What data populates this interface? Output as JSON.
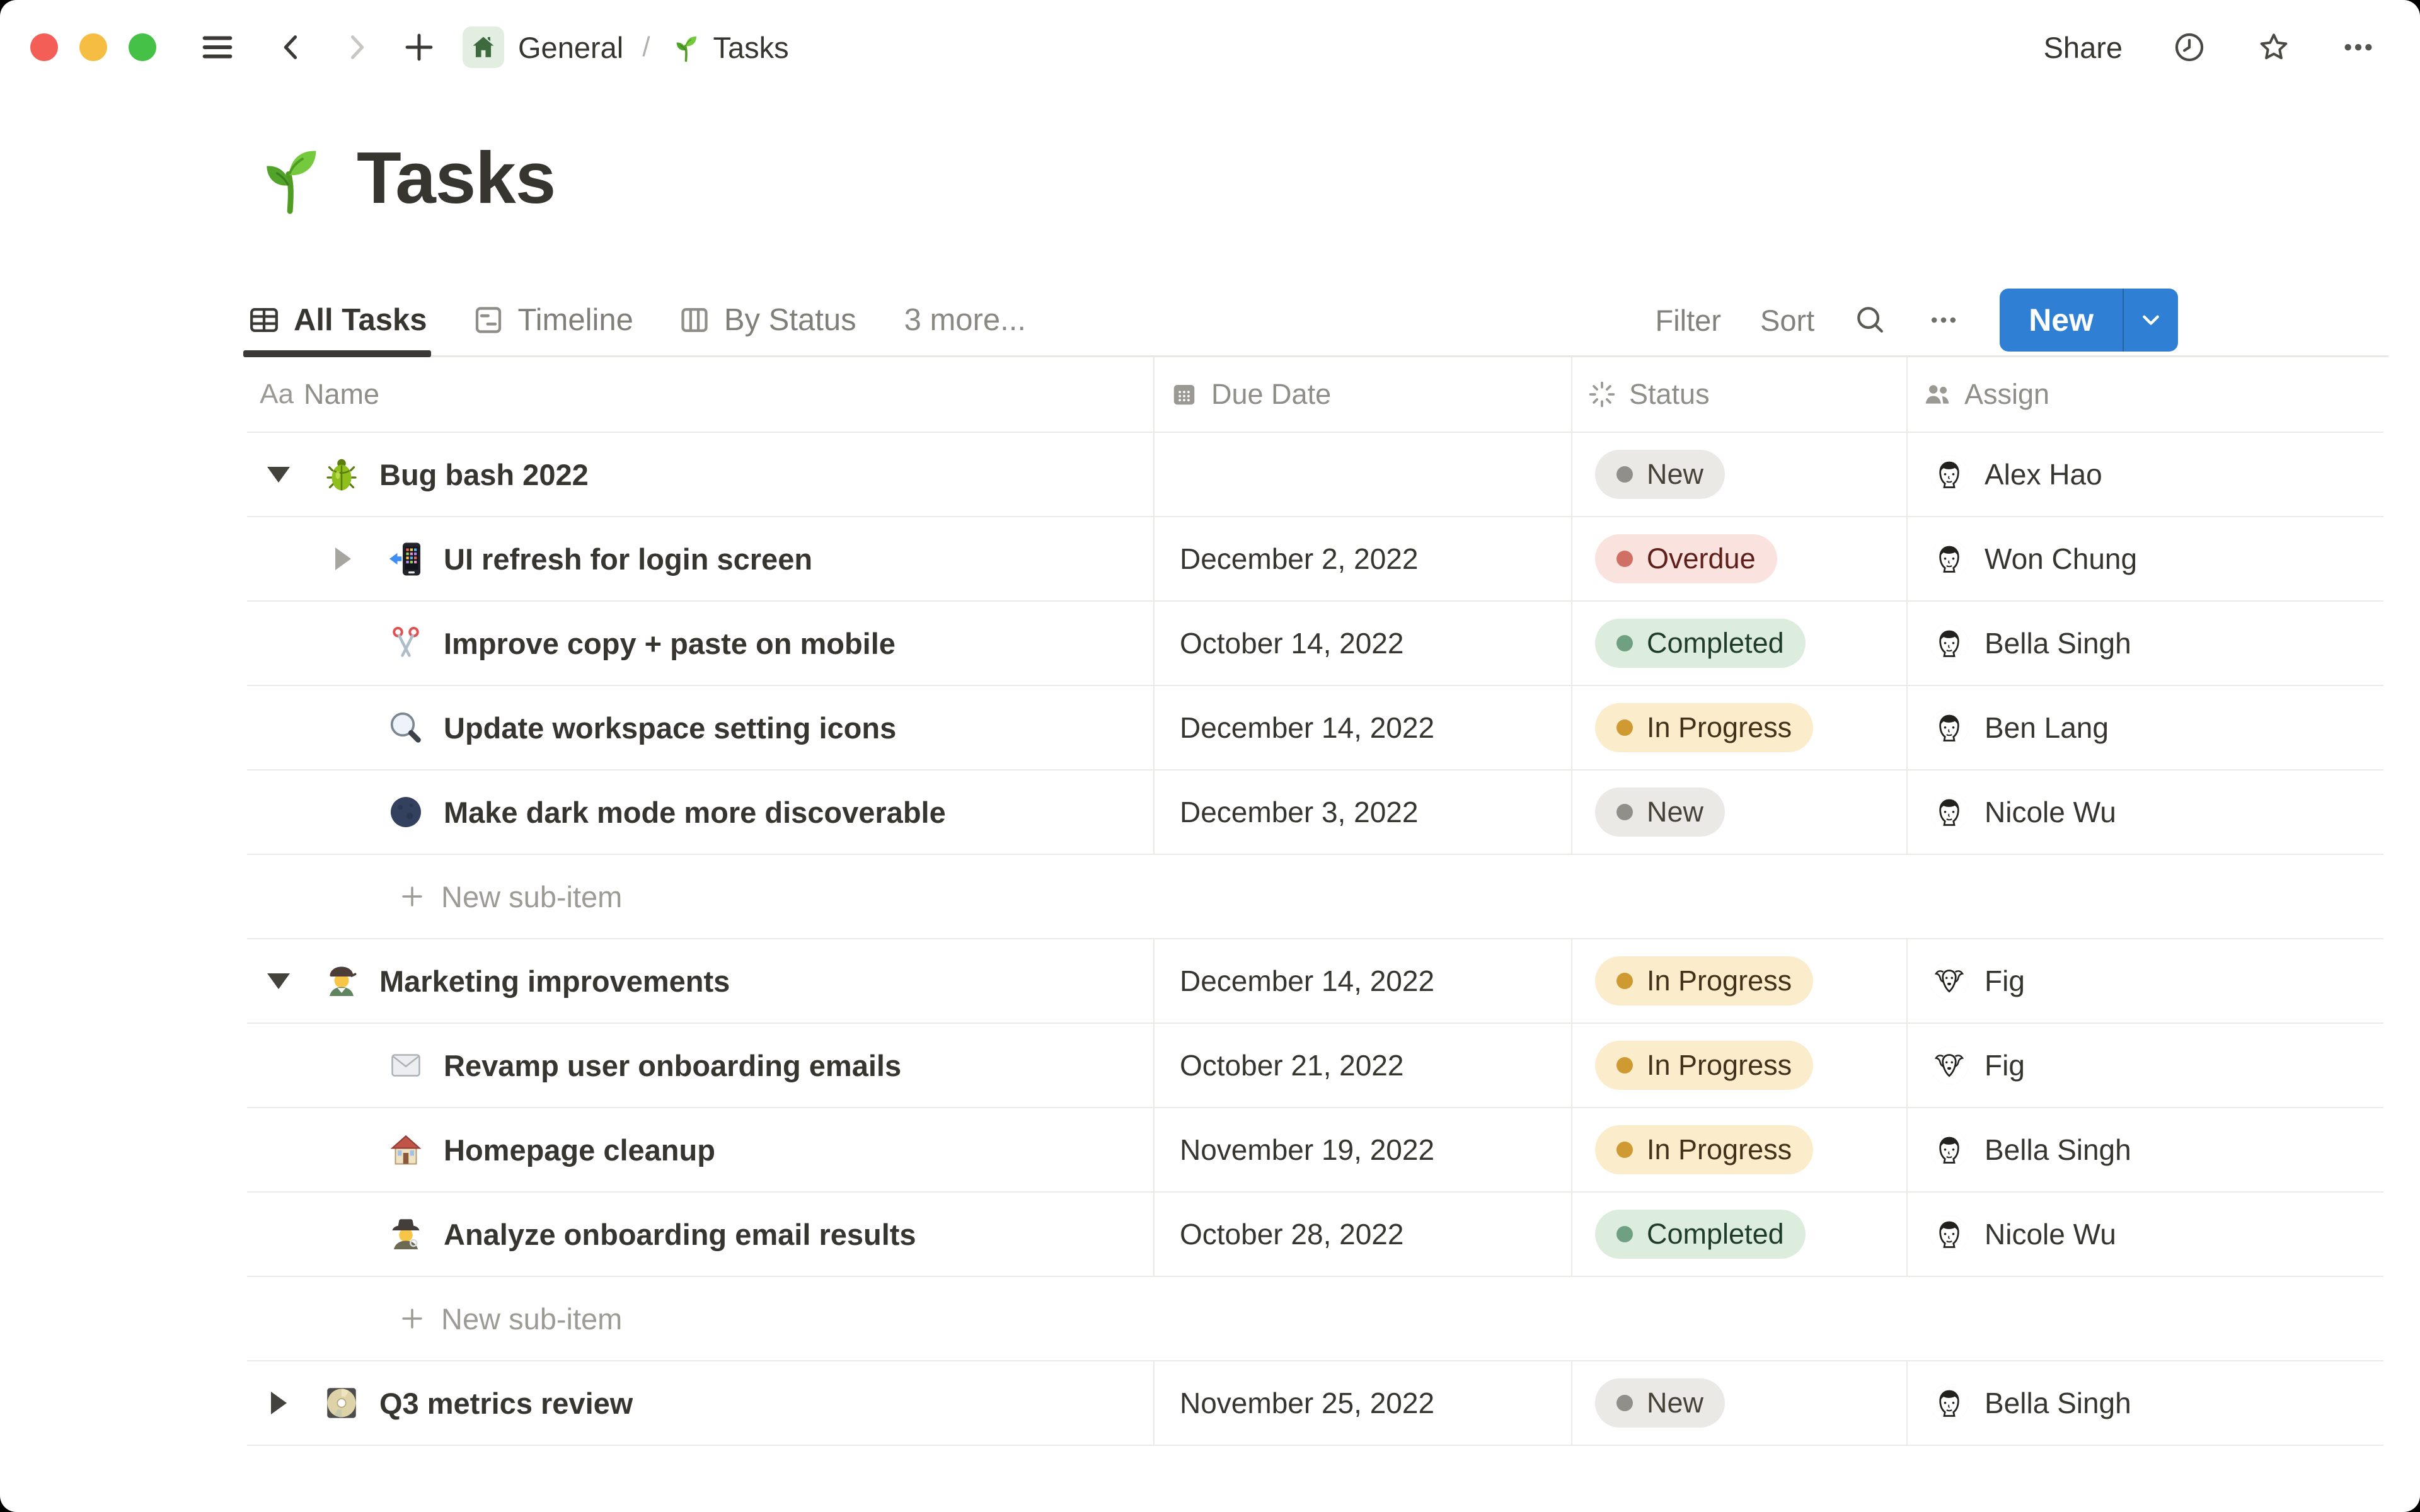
{
  "window_chrome": {
    "traffic_lights": [
      "close",
      "minimize",
      "zoom"
    ],
    "breadcrumb": {
      "workspace": "General",
      "separator": "/",
      "page": "Tasks",
      "workspace_icon": "home-icon",
      "page_icon": "seedling-icon"
    },
    "share_label": "Share"
  },
  "header": {
    "icon": "seedling-icon",
    "title": "Tasks"
  },
  "toolbar": {
    "tabs": [
      {
        "label": "All Tasks",
        "icon": "table-icon",
        "active": true
      },
      {
        "label": "Timeline",
        "icon": "timeline-icon",
        "active": false
      },
      {
        "label": "By Status",
        "icon": "board-icon",
        "active": false
      }
    ],
    "more_tabs_label": "3 more...",
    "filter_label": "Filter",
    "sort_label": "Sort",
    "new_button_label": "New"
  },
  "table": {
    "columns": [
      {
        "label": "Name",
        "icon": "text-icon"
      },
      {
        "label": "Due Date",
        "icon": "calendar-icon"
      },
      {
        "label": "Status",
        "icon": "status-burst-icon"
      },
      {
        "label": "Assign",
        "icon": "people-icon"
      }
    ],
    "new_sub_item_label": "New sub-item",
    "rows": [
      {
        "type": "task",
        "level": 1,
        "toggle": "open",
        "icon": "beetle",
        "name": "Bug bash 2022",
        "due": "",
        "status": {
          "label": "New",
          "type": "new"
        },
        "assignee": {
          "name": "Alex Hao",
          "avatar": "person"
        }
      },
      {
        "type": "task",
        "level": 2,
        "toggle": "closed-muted",
        "icon": "phone",
        "name": "UI refresh for login screen",
        "due": "December 2, 2022",
        "status": {
          "label": "Overdue",
          "type": "overdue"
        },
        "assignee": {
          "name": "Won Chung",
          "avatar": "person"
        }
      },
      {
        "type": "task",
        "level": 2,
        "toggle": "none",
        "icon": "scissors",
        "name": "Improve copy + paste on mobile",
        "due": "October 14, 2022",
        "status": {
          "label": "Completed",
          "type": "completed"
        },
        "assignee": {
          "name": "Bella Singh",
          "avatar": "person"
        }
      },
      {
        "type": "task",
        "level": 2,
        "toggle": "none",
        "icon": "magnifier",
        "name": "Update workspace setting icons",
        "due": "December 14, 2022",
        "status": {
          "label": "In Progress",
          "type": "in-progress"
        },
        "assignee": {
          "name": "Ben Lang",
          "avatar": "person"
        }
      },
      {
        "type": "task",
        "level": 2,
        "toggle": "none",
        "icon": "moon",
        "name": "Make dark mode more discoverable",
        "due": "December 3, 2022",
        "status": {
          "label": "New",
          "type": "new"
        },
        "assignee": {
          "name": "Nicole Wu",
          "avatar": "person"
        }
      },
      {
        "type": "new-sub-item"
      },
      {
        "type": "task",
        "level": 1,
        "toggle": "open",
        "icon": "artist",
        "name": "Marketing improvements",
        "due": "December 14, 2022",
        "status": {
          "label": "In Progress",
          "type": "in-progress"
        },
        "assignee": {
          "name": "Fig",
          "avatar": "dog"
        }
      },
      {
        "type": "task",
        "level": 2,
        "toggle": "none",
        "icon": "envelope",
        "name": "Revamp user onboarding emails",
        "due": "October 21, 2022",
        "status": {
          "label": "In Progress",
          "type": "in-progress"
        },
        "assignee": {
          "name": "Fig",
          "avatar": "dog"
        }
      },
      {
        "type": "task",
        "level": 2,
        "toggle": "none",
        "icon": "house",
        "name": "Homepage cleanup",
        "due": "November 19, 2022",
        "status": {
          "label": "In Progress",
          "type": "in-progress"
        },
        "assignee": {
          "name": "Bella Singh",
          "avatar": "person"
        }
      },
      {
        "type": "task",
        "level": 2,
        "toggle": "none",
        "icon": "detective",
        "name": "Analyze onboarding email results",
        "due": "October 28, 2022",
        "status": {
          "label": "Completed",
          "type": "completed"
        },
        "assignee": {
          "name": "Nicole Wu",
          "avatar": "person"
        }
      },
      {
        "type": "new-sub-item"
      },
      {
        "type": "task",
        "level": 1,
        "toggle": "closed",
        "icon": "cd",
        "name": "Q3 metrics review",
        "due": "November 25, 2022",
        "status": {
          "label": "New",
          "type": "new"
        },
        "assignee": {
          "name": "Bella Singh",
          "avatar": "person"
        }
      }
    ]
  },
  "colors": {
    "accent_blue": "#2f80d4",
    "text_dark": "#373530",
    "text_gray": "#82817d",
    "border": "#ebeae7",
    "status_new_bg": "#eae9e6",
    "status_overdue_bg": "#fae2de",
    "status_completed_bg": "#dcedde",
    "status_in_progress_bg": "#fbedcc"
  }
}
